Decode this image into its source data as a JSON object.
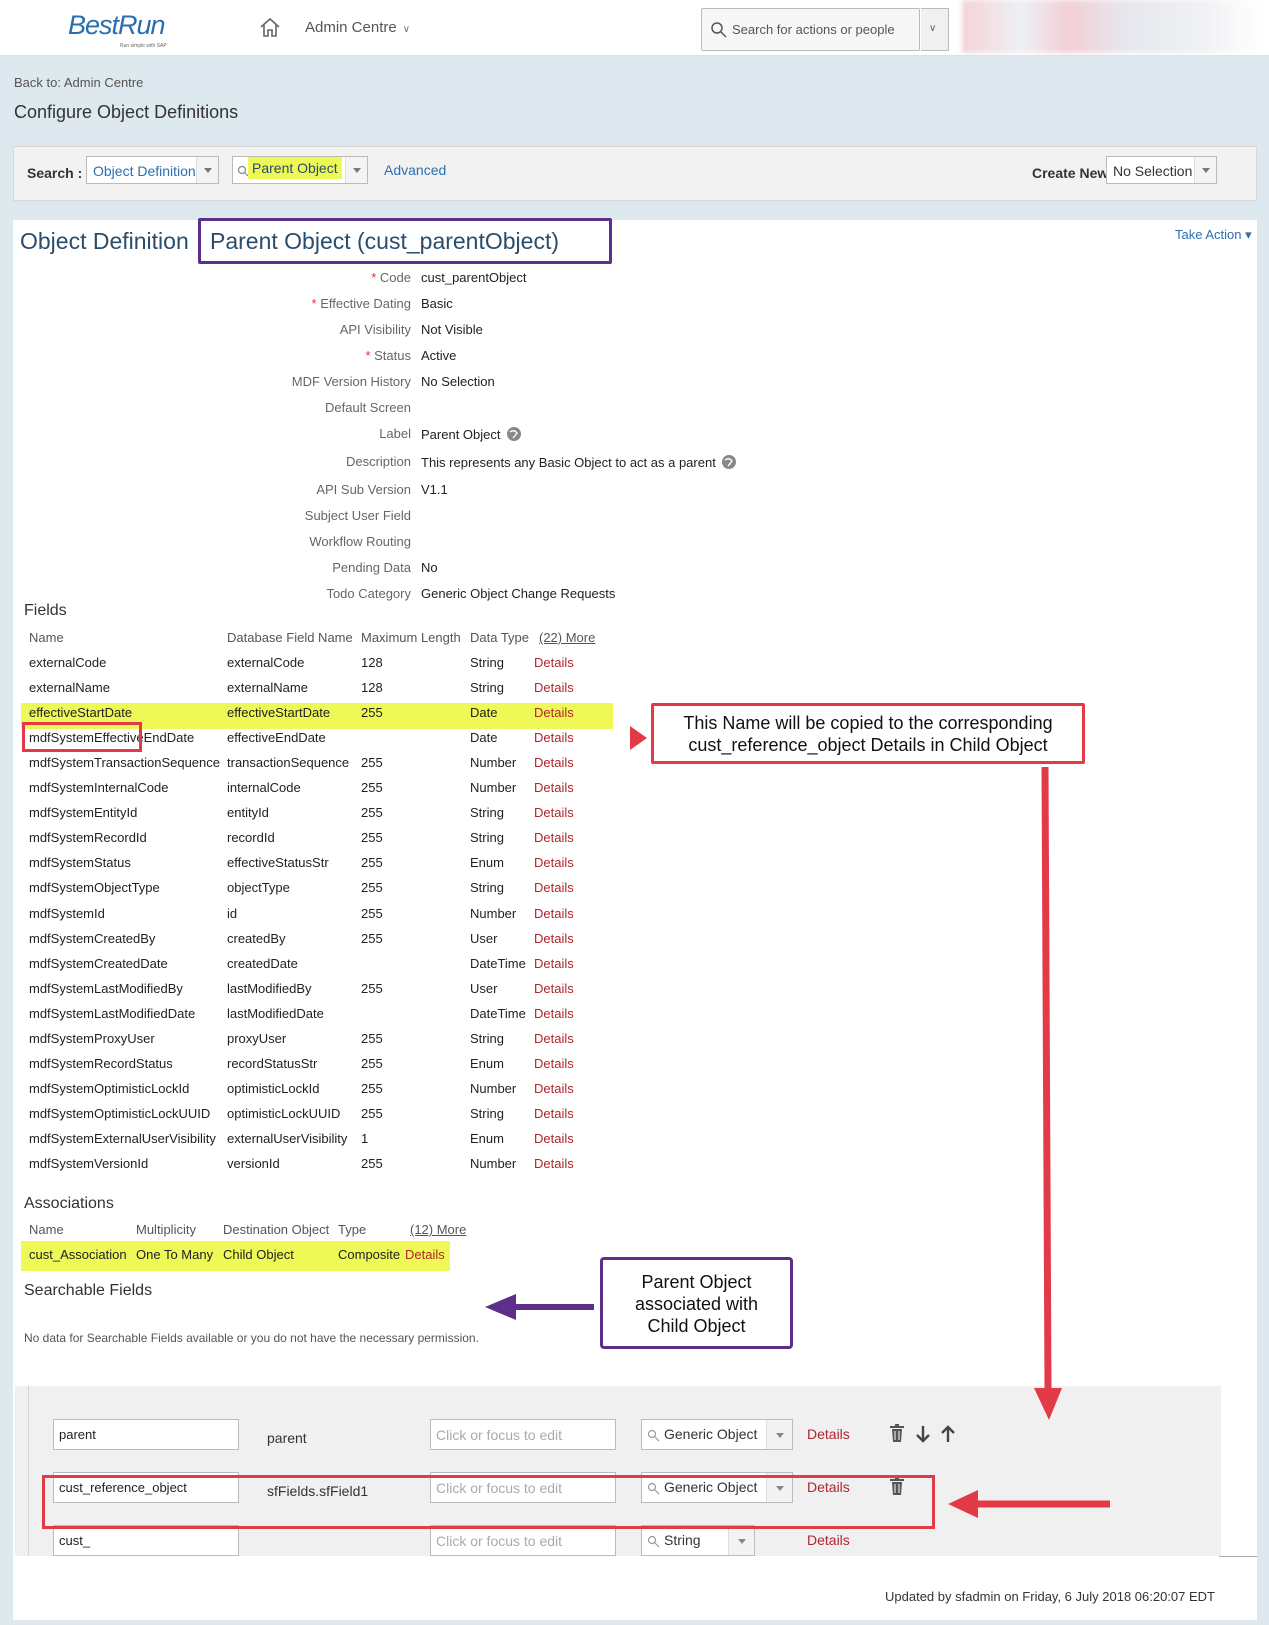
{
  "shell": {
    "logo": "BestRun",
    "logo_sub": "Run simple with SAP",
    "nav_label": "Admin Centre",
    "search_placeholder": "Search for actions or people"
  },
  "page": {
    "back_link": "Back to: Admin Centre",
    "title": "Configure Object Definitions"
  },
  "search_bar": {
    "label": "Search :",
    "type_value": "Object Definition",
    "object_value": "Parent Object",
    "advanced": "Advanced",
    "create_label": "Create New :",
    "create_value": "No Selection"
  },
  "object": {
    "heading": "Object Definition",
    "name": "Parent Object (cust_parentObject)",
    "take_action": "Take Action"
  },
  "properties": [
    {
      "label": "Code",
      "value": "cust_parentObject",
      "required": true
    },
    {
      "label": "Effective Dating",
      "value": "Basic",
      "required": true
    },
    {
      "label": "API Visibility",
      "value": "Not Visible",
      "required": false
    },
    {
      "label": "Status",
      "value": "Active",
      "required": true
    },
    {
      "label": "MDF Version History",
      "value": "No Selection",
      "required": false
    },
    {
      "label": "Default Screen",
      "value": "",
      "required": false
    },
    {
      "label": "Label",
      "value": "Parent Object",
      "required": false
    },
    {
      "label": "Description",
      "value": "This represents any Basic Object to act as a parent",
      "required": false
    },
    {
      "label": "API Sub Version",
      "value": "V1.1",
      "required": false
    },
    {
      "label": "Subject User Field",
      "value": "",
      "required": false
    },
    {
      "label": "Workflow Routing",
      "value": "",
      "required": false
    },
    {
      "label": "Pending Data",
      "value": "No",
      "required": false
    },
    {
      "label": "Todo Category",
      "value": "Generic Object Change Requests",
      "required": false
    }
  ],
  "fields": {
    "title": "Fields",
    "headers": [
      "Name",
      "Database Field Name",
      "Maximum Length",
      "Data Type"
    ],
    "more": "(22) More",
    "details_label": "Details",
    "rows": [
      [
        "externalCode",
        "externalCode",
        "128",
        "String"
      ],
      [
        "externalName",
        "externalName",
        "128",
        "String"
      ],
      [
        "effectiveStartDate",
        "effectiveStartDate",
        "255",
        "Date"
      ],
      [
        "mdfSystemEffectiveEndDate",
        "effectiveEndDate",
        "",
        "Date"
      ],
      [
        "mdfSystemTransactionSequence",
        "transactionSequence",
        "255",
        "Number"
      ],
      [
        "mdfSystemInternalCode",
        "internalCode",
        "255",
        "Number"
      ],
      [
        "mdfSystemEntityId",
        "entityId",
        "255",
        "String"
      ],
      [
        "mdfSystemRecordId",
        "recordId",
        "255",
        "String"
      ],
      [
        "mdfSystemStatus",
        "effectiveStatusStr",
        "255",
        "Enum"
      ],
      [
        "mdfSystemObjectType",
        "objectType",
        "255",
        "String"
      ],
      [
        "mdfSystemId",
        "id",
        "255",
        "Number"
      ],
      [
        "mdfSystemCreatedBy",
        "createdBy",
        "255",
        "User"
      ],
      [
        "mdfSystemCreatedDate",
        "createdDate",
        "",
        "DateTime"
      ],
      [
        "mdfSystemLastModifiedBy",
        "lastModifiedBy",
        "255",
        "User"
      ],
      [
        "mdfSystemLastModifiedDate",
        "lastModifiedDate",
        "",
        "DateTime"
      ],
      [
        "mdfSystemProxyUser",
        "proxyUser",
        "255",
        "String"
      ],
      [
        "mdfSystemRecordStatus",
        "recordStatusStr",
        "255",
        "Enum"
      ],
      [
        "mdfSystemOptimisticLockId",
        "optimisticLockId",
        "255",
        "Number"
      ],
      [
        "mdfSystemOptimisticLockUUID",
        "optimisticLockUUID",
        "255",
        "String"
      ],
      [
        "mdfSystemExternalUserVisibility",
        "externalUserVisibility",
        "1",
        "Enum"
      ],
      [
        "mdfSystemVersionId",
        "versionId",
        "255",
        "Number"
      ]
    ]
  },
  "associations": {
    "title": "Associations",
    "headers": [
      "Name",
      "Multiplicity",
      "Destination Object",
      "Type"
    ],
    "more": "(12) More",
    "rows": [
      [
        "cust_Association",
        "One To Many",
        "Child Object",
        "Composite",
        "Details"
      ]
    ]
  },
  "searchable": {
    "title": "Searchable Fields",
    "empty": "No data for Searchable Fields available or you do not have the necessary permission."
  },
  "edit_rows": [
    {
      "name": "parent",
      "field": "parent",
      "placeholder": "Click or focus to edit",
      "type": "Generic Object",
      "details": "Details"
    },
    {
      "name": "cust_reference_object",
      "field": "sfFields.sfField1",
      "placeholder": "Click or focus to edit",
      "type": "Generic Object",
      "details": "Details"
    },
    {
      "name": "cust_",
      "field": "",
      "placeholder": "Click or focus to edit",
      "type": "String",
      "details": "Details"
    }
  ],
  "updated": "Updated by sfadmin on Friday, 6 July 2018 06:20:07 EDT",
  "annotations": {
    "copy_note": "This Name will be copied to the corresponding cust_reference_object Details in Child Object",
    "copy_note_line1": "This Name will be copied to the corresponding",
    "copy_note_line2": "cust_reference_object Details in Child Object",
    "assoc_note_line1": "Parent Object",
    "assoc_note_line2": "associated with",
    "assoc_note_line3": "Child Object"
  },
  "colors": {
    "highlight": "#eef857",
    "link": "#2a6fb0",
    "details": "#b0262c",
    "annotation_red": "#e23b47",
    "annotation_purple": "#5e2f8a"
  }
}
